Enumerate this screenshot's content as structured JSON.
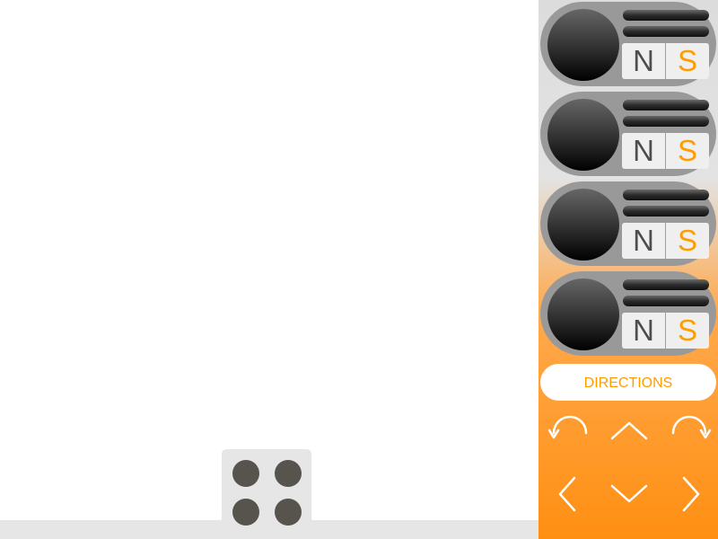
{
  "magnets": [
    {
      "north_label": "N",
      "south_label": "S"
    },
    {
      "north_label": "N",
      "south_label": "S"
    },
    {
      "north_label": "N",
      "south_label": "S"
    },
    {
      "north_label": "N",
      "south_label": "S"
    }
  ],
  "directions": {
    "label": "DIRECTIONS"
  },
  "controls": [
    {
      "icon": "rotate-left-icon"
    },
    {
      "icon": "arrow-up-icon"
    },
    {
      "icon": "rotate-right-icon"
    },
    {
      "icon": "arrow-left-icon"
    },
    {
      "icon": "arrow-down-icon"
    },
    {
      "icon": "arrow-right-icon"
    }
  ],
  "colors": {
    "accent": "#ff9c00",
    "panel_top": "#dcdcdc",
    "panel_bottom": "#ff8f12",
    "slot": "#999999",
    "peg": "#57544e",
    "floor": "#e6e6e6"
  }
}
